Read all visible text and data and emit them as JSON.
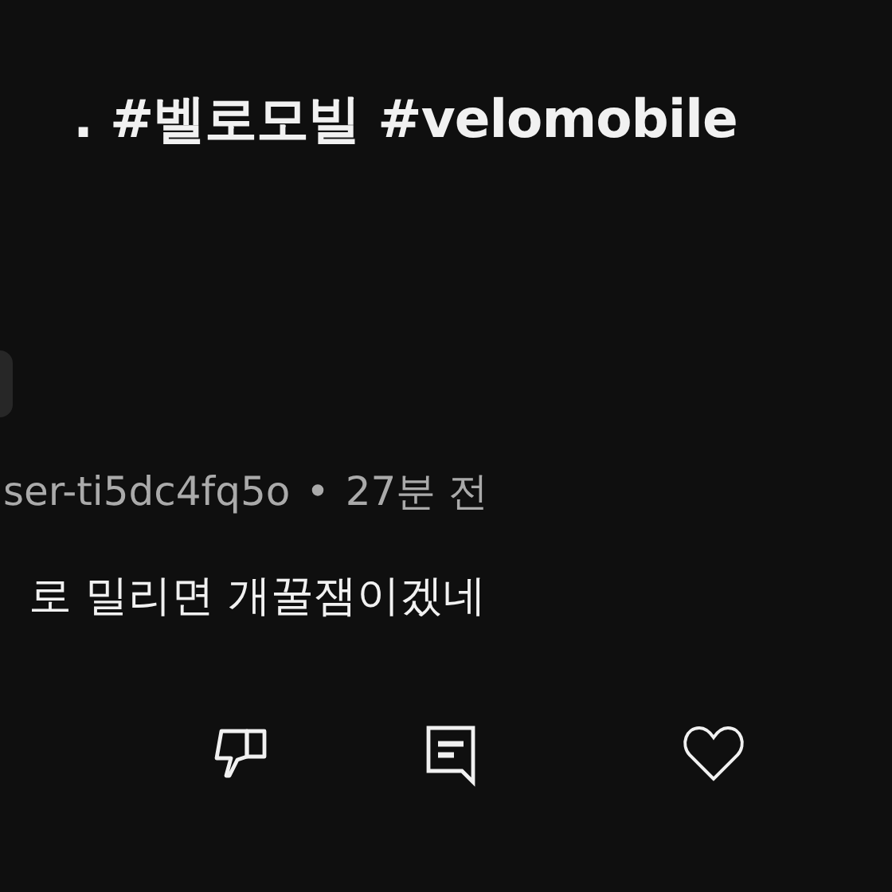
{
  "title": ". #벨로모빌 #velomobile",
  "comment": {
    "author": "ser-ti5dc4fq5o",
    "separator": "•",
    "time": "27분 전",
    "text": "로 밀리면 개꿀잼이겠네"
  },
  "actions": [
    {
      "kind": "dislike"
    },
    {
      "kind": "reply"
    },
    {
      "kind": "like"
    }
  ]
}
